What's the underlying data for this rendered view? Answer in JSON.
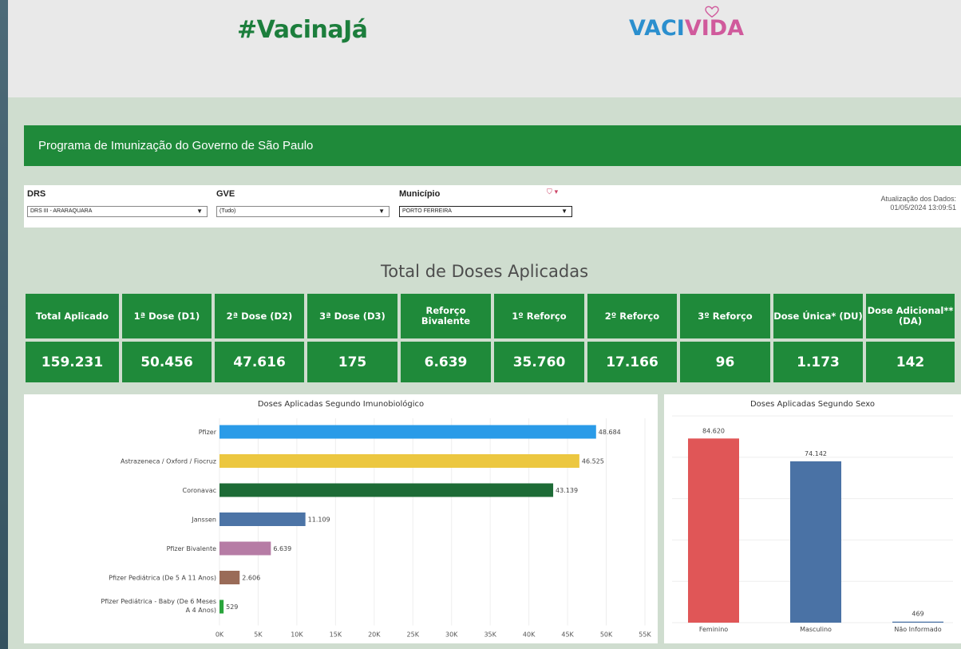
{
  "header": {
    "hashtag": "#VacinaJá",
    "logo_part1": "VACI",
    "logo_part2": "VIDA",
    "colors": {
      "green": "#1c7e3c",
      "blue": "#2b8fce",
      "pink": "#d05a9c"
    }
  },
  "banner": {
    "title": "Programa de Imunização do Governo de São Paulo"
  },
  "filters": {
    "drs": {
      "label": "DRS",
      "value": "DRS III - ARARAQUARA"
    },
    "gve": {
      "label": "GVE",
      "value": "(Tudo)"
    },
    "municipio": {
      "label": "Município",
      "value": "PORTO FERREIRA"
    },
    "filter_icon": "filter-icon",
    "update_label": "Atualização dos Dados:",
    "update_value": "01/05/2024 13:09:51"
  },
  "summary": {
    "title": "Total de Doses Aplicadas",
    "kpis": [
      {
        "label": "Total Aplicado",
        "value": "159.231"
      },
      {
        "label": "1ª Dose (D1)",
        "value": "50.456"
      },
      {
        "label": "2ª Dose (D2)",
        "value": "47.616"
      },
      {
        "label": "3ª Dose (D3)",
        "value": "175"
      },
      {
        "label": "Reforço Bivalente",
        "value": "6.639"
      },
      {
        "label": "1º Reforço",
        "value": "35.760"
      },
      {
        "label": "2º Reforço",
        "value": "17.166"
      },
      {
        "label": "3º Reforço",
        "value": "96"
      },
      {
        "label": "Dose Única* (DU)",
        "value": "1.173"
      },
      {
        "label": "Dose Adicional** (DA)",
        "value": "142"
      }
    ]
  },
  "chart_data": [
    {
      "type": "bar",
      "orientation": "horizontal",
      "title": "Doses Aplicadas Segundo Imunobiológico",
      "categories": [
        "Pfizer",
        "Astrazeneca / Oxford / Fiocruz",
        "Coronavac",
        "Janssen",
        "Pfizer Bivalente",
        "Pfizer Pediátrica (De 5 A 11 Anos)",
        "Pfizer Pediátrica - Baby (De 6 Meses A 4 Anos)"
      ],
      "values": [
        48684,
        46525,
        43139,
        11109,
        6639,
        2606,
        529
      ],
      "value_labels": [
        "48.684",
        "46.525",
        "43.139",
        "11.109",
        "6.639",
        "2.606",
        "529"
      ],
      "colors": [
        "#2a9be8",
        "#ecc740",
        "#1d6b36",
        "#4c74a6",
        "#b67ca5",
        "#9a6b58",
        "#2aa53c"
      ],
      "xlim": [
        0,
        55000
      ],
      "xticks": [
        "0K",
        "5K",
        "10K",
        "15K",
        "20K",
        "25K",
        "30K",
        "35K",
        "40K",
        "45K",
        "50K",
        "55K"
      ],
      "grid": true
    },
    {
      "type": "bar",
      "title": "Doses Aplicadas Segundo Sexo",
      "categories": [
        "Feminino",
        "Masculino",
        "Não Informado"
      ],
      "values": [
        84620,
        74142,
        469
      ],
      "value_labels": [
        "84.620",
        "74.142",
        "469"
      ],
      "colors": [
        "#e05657",
        "#4a72a5",
        "#4a72a5"
      ],
      "ylim": [
        0,
        95000
      ],
      "grid": true
    }
  ]
}
